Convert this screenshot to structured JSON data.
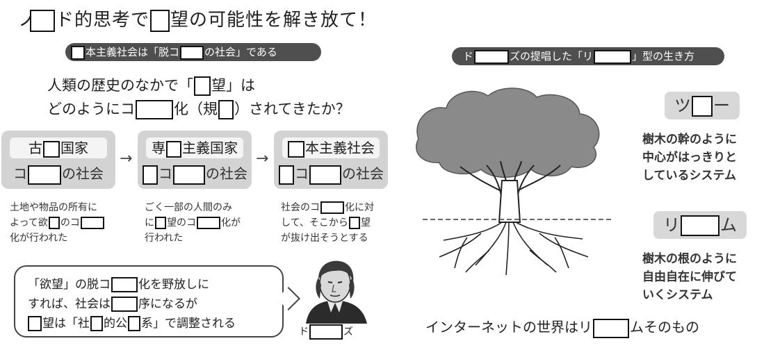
{
  "title": {
    "p1": "ノ",
    "p2": "ド的思考で",
    "p3": "望の可能性を解き放て！"
  },
  "left_header": {
    "p2": "本主義社会は「脱コ",
    "p3": "の社会」である"
  },
  "question": {
    "l1_p1": "人類の歴史のなかで「",
    "l1_p2": "望」は",
    "l2_p1": "どのようにコ",
    "l2_p2": "化（規",
    "l2_p3": "）されてきたか？"
  },
  "cards": [
    {
      "top_p1": "古",
      "top_p2": "国家",
      "bot_p1": "コ",
      "bot_p2": "の社会"
    },
    {
      "top_p1": "専",
      "top_p2": "主義国家",
      "bot_p2": "コ",
      "bot_p3": "の社会"
    },
    {
      "top_p2": "本主義社会",
      "bot_p2": "コ",
      "bot_p3": "の社会"
    }
  ],
  "arrow": "→",
  "notes": [
    {
      "l1": "土地や物品の所有に",
      "l2_p1": "よって欲",
      "l2_p2": "のコ",
      "l3": "化が行われた"
    },
    {
      "l1": "ごく一部の人間のみ",
      "l2_p1": "に",
      "l2_p2": "望のコ",
      "l2_p3": "化が",
      "l3": "行われた"
    },
    {
      "l1_p1": "社会のコ",
      "l1_p2": "化に対",
      "l2_p1": "して、そこから",
      "l2_p2": "望",
      "l3": "が抜け出そうとする"
    }
  ],
  "bubble": {
    "l1_p1": "「欲望」の脱コ",
    "l1_p2": "化を野放しに",
    "l2_p1": "すれば、社会は",
    "l2_p2": "序になるが",
    "l3_p2": "望は「社",
    "l3_p3": "的公",
    "l3_p4": "系」で調整される"
  },
  "portrait_caption": {
    "p1": "ド",
    "p2": "ズ"
  },
  "right_header": {
    "p1": "ド",
    "p2": "ズの提唱した「リ",
    "p3": "」型の生き方"
  },
  "tree_label": {
    "p1": "ツ",
    "p2": "ー"
  },
  "tree_desc": [
    "樹木の幹のように",
    "中心がはっきりと",
    "しているシステム"
  ],
  "rhizome_label": {
    "p1": "リ",
    "p2": "ム"
  },
  "rhizome_desc": [
    "樹木の根のように",
    "自由自在に伸びて",
    "いくシステム"
  ],
  "bottom": {
    "p1": "インターネットの世界はリ",
    "p2": "ムそのもの"
  }
}
